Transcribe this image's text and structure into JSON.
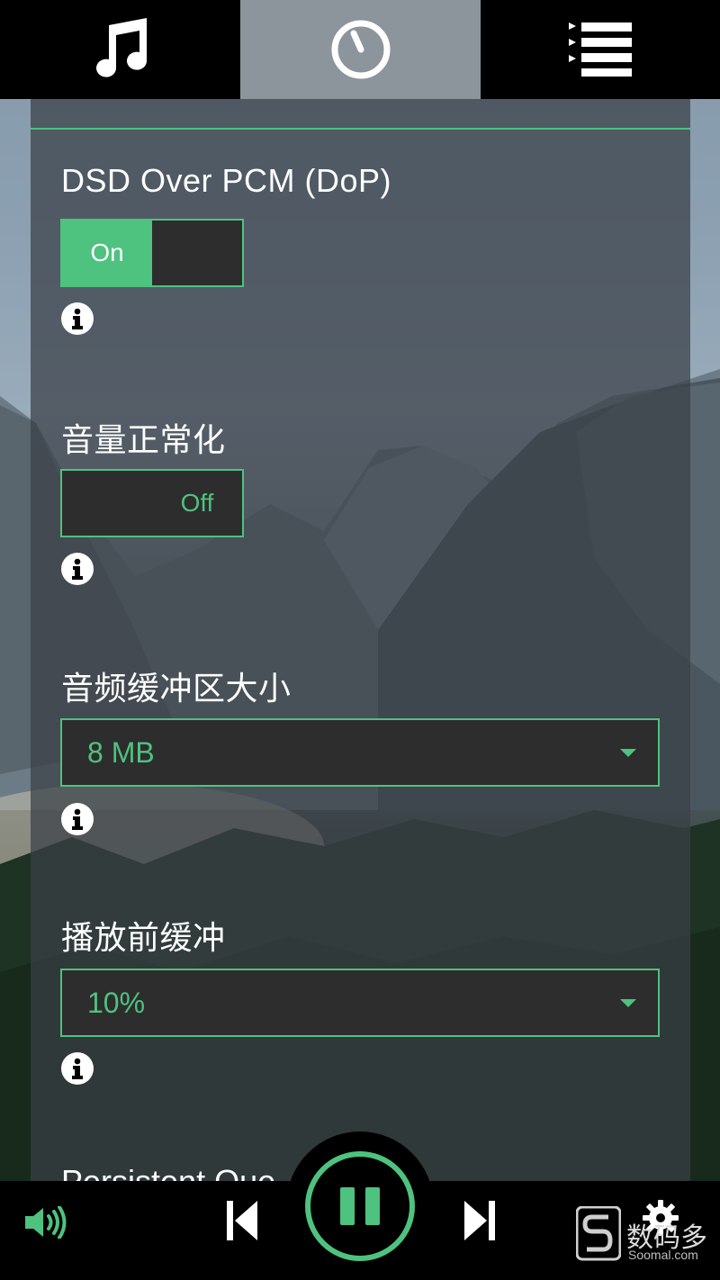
{
  "top_nav": {
    "tabs": [
      {
        "icon": "music-note-icon",
        "active": false
      },
      {
        "icon": "dial-icon",
        "active": true
      },
      {
        "icon": "playlist-icon",
        "active": false
      }
    ]
  },
  "settings": {
    "dop": {
      "title": "DSD Over PCM (DoP)",
      "state": "On"
    },
    "normalization": {
      "title": "音量正常化",
      "state": "Off"
    },
    "buffer_size": {
      "title": "音频缓冲区大小",
      "value": "8 MB"
    },
    "prebuffer": {
      "title": "播放前缓冲",
      "value": "10%"
    },
    "persistent_queue": {
      "title": "Persistent Que"
    }
  },
  "player": {
    "volume_icon": "volume-icon",
    "prev_icon": "skip-previous-icon",
    "pause_icon": "pause-icon",
    "next_icon": "skip-next-icon",
    "settings_icon": "gear-icon"
  },
  "watermark": {
    "brand": "数码多",
    "site": "Soomal.com"
  },
  "colors": {
    "accent": "#4ec27f",
    "panel": "#3a4046",
    "bar": "#000000",
    "active_tab": "#8c959b"
  }
}
